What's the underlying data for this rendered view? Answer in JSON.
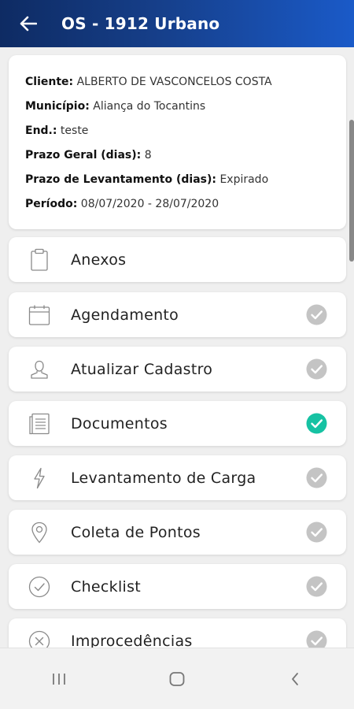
{
  "header": {
    "title": "OS - 1912 Urbano",
    "back_icon": "arrow-left-icon"
  },
  "info": {
    "cliente": {
      "label": "Cliente:",
      "value": "ALBERTO DE VASCONCELOS COSTA"
    },
    "municipio": {
      "label": "Município:",
      "value": "Aliança do Tocantins"
    },
    "endereco": {
      "label": "End.:",
      "value": "teste"
    },
    "prazo_geral": {
      "label": "Prazo Geral (dias):",
      "value": "8"
    },
    "prazo_levantamento": {
      "label": "Prazo de Levantamento (dias):",
      "value": "Expirado"
    },
    "periodo": {
      "label": "Período:",
      "value": "08/07/2020 - 28/07/2020"
    }
  },
  "menu": [
    {
      "label": "Anexos",
      "icon": "clipboard-icon",
      "status": "none"
    },
    {
      "label": "Agendamento",
      "icon": "calendar-icon",
      "status": "pending"
    },
    {
      "label": "Atualizar Cadastro",
      "icon": "user-icon",
      "status": "pending"
    },
    {
      "label": "Documentos",
      "icon": "document-icon",
      "status": "done"
    },
    {
      "label": "Levantamento de Carga",
      "icon": "lightning-icon",
      "status": "pending"
    },
    {
      "label": "Coleta de Pontos",
      "icon": "map-pin-icon",
      "status": "pending"
    },
    {
      "label": "Checklist",
      "icon": "check-circle-icon",
      "status": "pending"
    },
    {
      "label": "Improcedências",
      "icon": "x-circle-icon",
      "status": "pending"
    }
  ],
  "colors": {
    "accent": "#16c2a3",
    "pending": "#c4c4c4",
    "appbar_start": "#0e2b63",
    "appbar_end": "#1a5ac8"
  },
  "navbar": {
    "recent_icon": "recent-apps-icon",
    "home_icon": "home-icon",
    "back_icon": "back-chevron-icon"
  }
}
